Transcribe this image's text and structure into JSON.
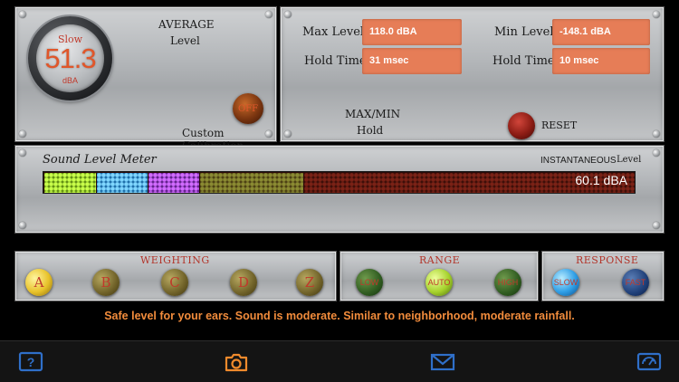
{
  "average_panel": {
    "title": "AVERAGE",
    "subtitle": "Level",
    "dial_mode": "Slow",
    "dial_value": "51.3",
    "dial_unit": "dBA",
    "custom_cal_label": "Custom Calibration",
    "custom_cal_button": "OFF"
  },
  "maxmin_panel": {
    "max_level_label": "Max Level",
    "max_level_value": "118.0 dBA",
    "min_level_label": "Min Level",
    "min_level_value": "-148.1 dBA",
    "hold_time_label_1": "Hold Time",
    "hold_time_value_1": "31 msec",
    "hold_time_label_2": "Hold Time",
    "hold_time_value_2": "10 msec",
    "mode_title": "MAX/MIN",
    "mode_subtitle": "Hold",
    "reset_label": "RESET"
  },
  "meter": {
    "title": "Sound Level Meter",
    "instant_title": "INSTANTANEOUS",
    "instant_sub": "Level",
    "readout": "60.1 dBA"
  },
  "weighting": {
    "title": "WEIGHTING",
    "options": [
      "A",
      "B",
      "C",
      "D",
      "Z"
    ],
    "selected": "A"
  },
  "range": {
    "title": "RANGE",
    "options": [
      "LOW",
      "AUTO",
      "HIGH"
    ],
    "selected": "AUTO"
  },
  "response": {
    "title": "RESPONSE",
    "options": [
      "SLOW",
      "FAST"
    ],
    "selected": "SLOW"
  },
  "info_text": "Safe level for your ears. Sound is moderate. Similar to neighborhood, moderate rainfall.",
  "toolbar": {
    "icons": [
      "help-icon",
      "camera-icon",
      "mail-icon",
      "meter-settings-icon"
    ]
  },
  "colors": {
    "accent": "#e67d57",
    "info_text": "#f28c3c",
    "toolbar_icons": "#2f6fc9",
    "camera_icon": "#f08a2c"
  }
}
